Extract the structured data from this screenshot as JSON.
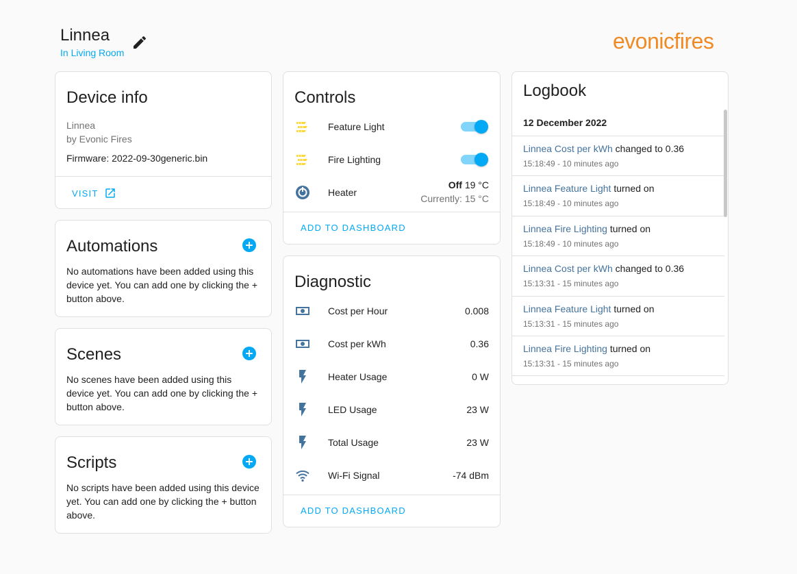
{
  "header": {
    "device_name": "Linnea",
    "area": "In Living Room",
    "brand": "evonicfires"
  },
  "device_info": {
    "title": "Device info",
    "model": "Linnea",
    "manufacturer": "by Evonic Fires",
    "firmware": "Firmware: 2022-09-30generic.bin",
    "visit_label": "VISIT"
  },
  "automations": {
    "title": "Automations",
    "message": "No automations have been added using this device yet. You can add one by clicking the + button above."
  },
  "scenes": {
    "title": "Scenes",
    "message": "No scenes have been added using this device yet. You can add one by clicking the + button above."
  },
  "scripts": {
    "title": "Scripts",
    "message": "No scripts have been added using this device yet. You can add one by clicking the + button above."
  },
  "controls": {
    "title": "Controls",
    "feature_light": {
      "label": "Feature Light",
      "state": "on",
      "icon": "led-strip-icon"
    },
    "fire_lighting": {
      "label": "Fire Lighting",
      "state": "on",
      "icon": "led-strip-icon"
    },
    "heater": {
      "label": "Heater",
      "state": "Off",
      "setpoint": "19 °C",
      "current": "Currently: 15 °C",
      "icon": "thermostat-icon"
    },
    "add_label": "ADD TO DASHBOARD"
  },
  "diagnostic": {
    "title": "Diagnostic",
    "rows": [
      {
        "label": "Cost per Hour",
        "value": "0.008",
        "icon": "cash-icon"
      },
      {
        "label": "Cost per kWh",
        "value": "0.36",
        "icon": "cash-icon"
      },
      {
        "label": "Heater Usage",
        "value": "0 W",
        "icon": "flash-icon"
      },
      {
        "label": "LED Usage",
        "value": "23 W",
        "icon": "flash-icon"
      },
      {
        "label": "Total Usage",
        "value": "23 W",
        "icon": "flash-icon"
      },
      {
        "label": "Wi-Fi Signal",
        "value": "-74 dBm",
        "icon": "wifi-icon"
      }
    ],
    "add_label": "ADD TO DASHBOARD"
  },
  "logbook": {
    "title": "Logbook",
    "date": "12 December 2022",
    "entries": [
      {
        "entity": "Linnea Cost per kWh",
        "action": "changed to 0.36",
        "time": "15:18:49 - 10 minutes ago"
      },
      {
        "entity": "Linnea Feature Light",
        "action": "turned on",
        "time": "15:18:49 - 10 minutes ago"
      },
      {
        "entity": "Linnea Fire Lighting",
        "action": "turned on",
        "time": "15:18:49 - 10 minutes ago"
      },
      {
        "entity": "Linnea Cost per kWh",
        "action": "changed to 0.36",
        "time": "15:13:31 - 15 minutes ago"
      },
      {
        "entity": "Linnea Feature Light",
        "action": "turned on",
        "time": "15:13:31 - 15 minutes ago"
      },
      {
        "entity": "Linnea Fire Lighting",
        "action": "turned on",
        "time": "15:13:31 - 15 minutes ago"
      }
    ]
  },
  "colors": {
    "accent": "#03a9f4",
    "icon": "#44739e",
    "brand": "#f08a24",
    "led": "#fdd835"
  }
}
